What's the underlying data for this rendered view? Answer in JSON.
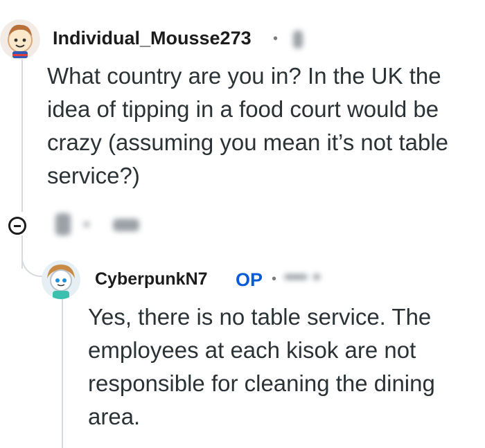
{
  "comment1": {
    "username": "Individual_Mousse273",
    "separator": "•",
    "avatar_icon": "snoo-avatar-icon",
    "body": "What country are you in? In the UK the idea of tipping in a food court would be crazy (assuming you mean it’s not table service?)"
  },
  "actions": {
    "collapse_icon": "collapse-minus-icon"
  },
  "comment2": {
    "username": "CyberpunkN7",
    "op_badge": "OP",
    "separator": "•",
    "avatar_icon": "snoo-avatar-icon",
    "body": "Yes, there is no table service. The employees at each kisok are not responsible for cleaning the dining area."
  },
  "colors": {
    "op_badge": "#0a5bd6",
    "thread_line": "#d7dadc",
    "text": "#2a3236"
  }
}
